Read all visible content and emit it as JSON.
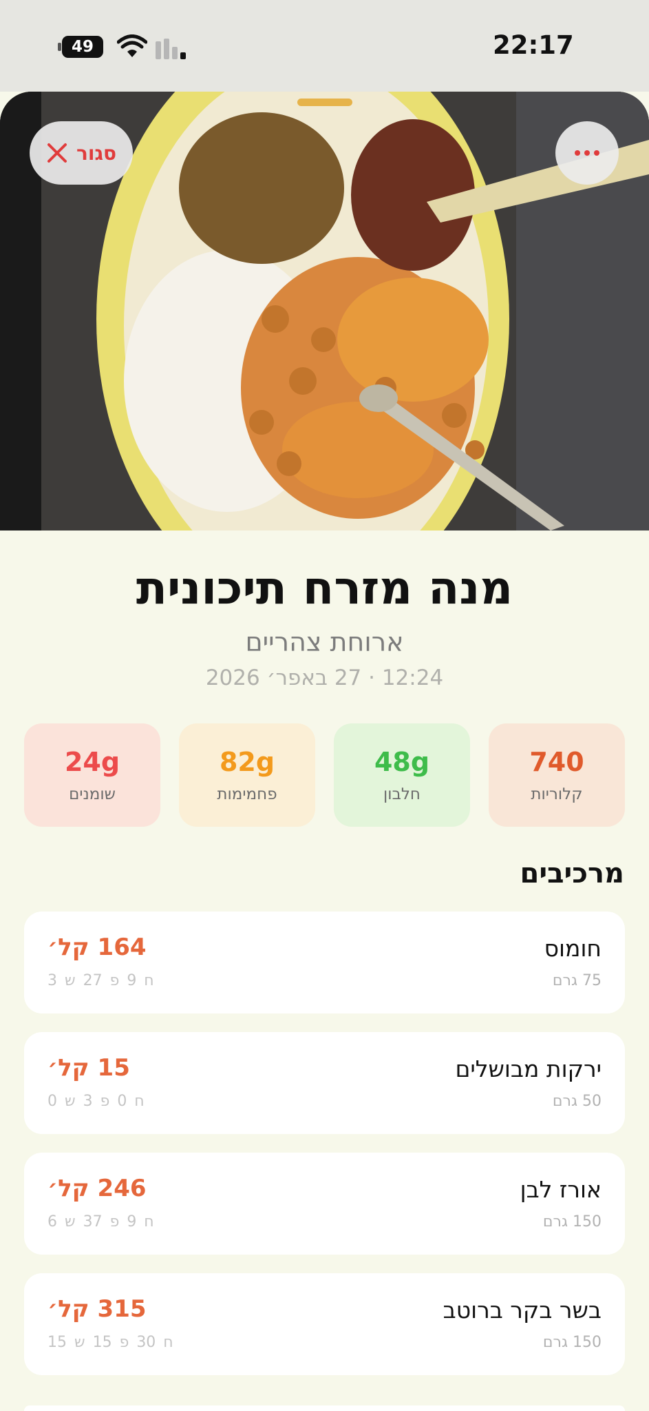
{
  "status_bar": {
    "time": "22:17",
    "battery": "49"
  },
  "photo": {
    "close_label": "סגור"
  },
  "meal": {
    "title": "מנה מזרח תיכונית",
    "meal_type": "ארוחת צהריים",
    "datetime": "12:24 · 27 באפר׳ 2026"
  },
  "macros": [
    {
      "value": "740",
      "label": "קלוריות",
      "color": "#e05a2b",
      "bg": "#f9e6d7"
    },
    {
      "value": "48g",
      "label": "חלבון",
      "color": "#3ebc4a",
      "bg": "#e3f5da"
    },
    {
      "value": "82g",
      "label": "פחמימות",
      "color": "#f39a1c",
      "bg": "#fbefd6"
    },
    {
      "value": "24g",
      "label": "שומנים",
      "color": "#ec4b4b",
      "bg": "#fbe3da"
    }
  ],
  "ingredients_title": "מרכיבים",
  "ingredients": [
    {
      "name": "חומוס",
      "weight": "75 גרם",
      "calories": "164 קל׳",
      "macros": "ח 9   פ 27   ש 3"
    },
    {
      "name": "ירקות מבושלים",
      "weight": "50 גרם",
      "calories": "15 קל׳",
      "macros": "ח 0   פ 3   ש 0"
    },
    {
      "name": "אורז לבן",
      "weight": "150 גרם",
      "calories": "246 קל׳",
      "macros": "ח 9   פ 37   ש 6"
    },
    {
      "name": "בשר בקר ברוטב",
      "weight": "150 גרם",
      "calories": "315 קל׳",
      "macros": "ח 30   פ 15   ש 15"
    }
  ]
}
